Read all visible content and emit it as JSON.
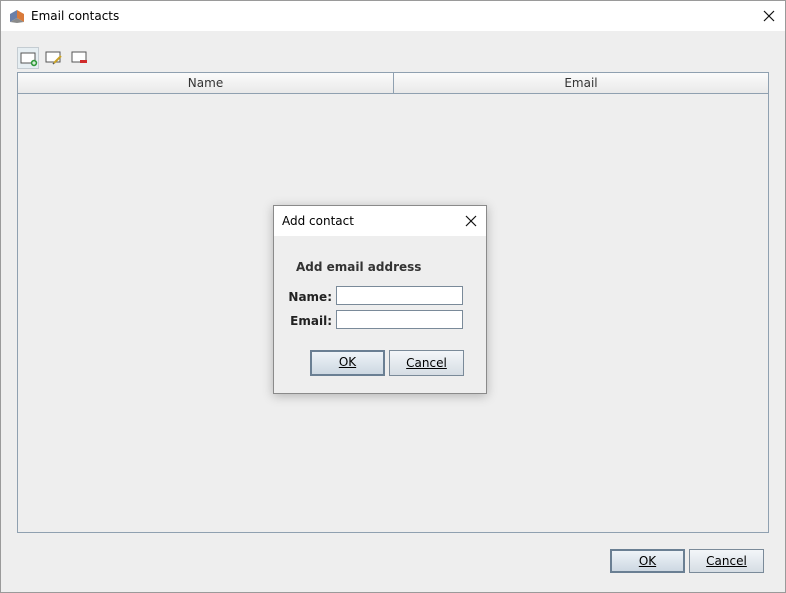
{
  "window": {
    "title": "Email contacts",
    "close_glyph": "✕"
  },
  "toolbar": {
    "buttons": [
      "add-contact-icon",
      "edit-contact-icon",
      "remove-contact-icon"
    ]
  },
  "table": {
    "columns": [
      "Name",
      "Email"
    ],
    "rows": []
  },
  "footer": {
    "ok_label": "OK",
    "cancel_label": "Cancel"
  },
  "dialog": {
    "title": "Add contact",
    "close_glyph": "✕",
    "heading": "Add email address",
    "name_label": "Name:",
    "name_value": "",
    "email_label": "Email:",
    "email_value": "",
    "ok_label": "OK",
    "cancel_label": "Cancel"
  },
  "colors": {
    "accent": "#6a7f93",
    "background": "#eeeeee",
    "border": "#8fa0b0"
  }
}
